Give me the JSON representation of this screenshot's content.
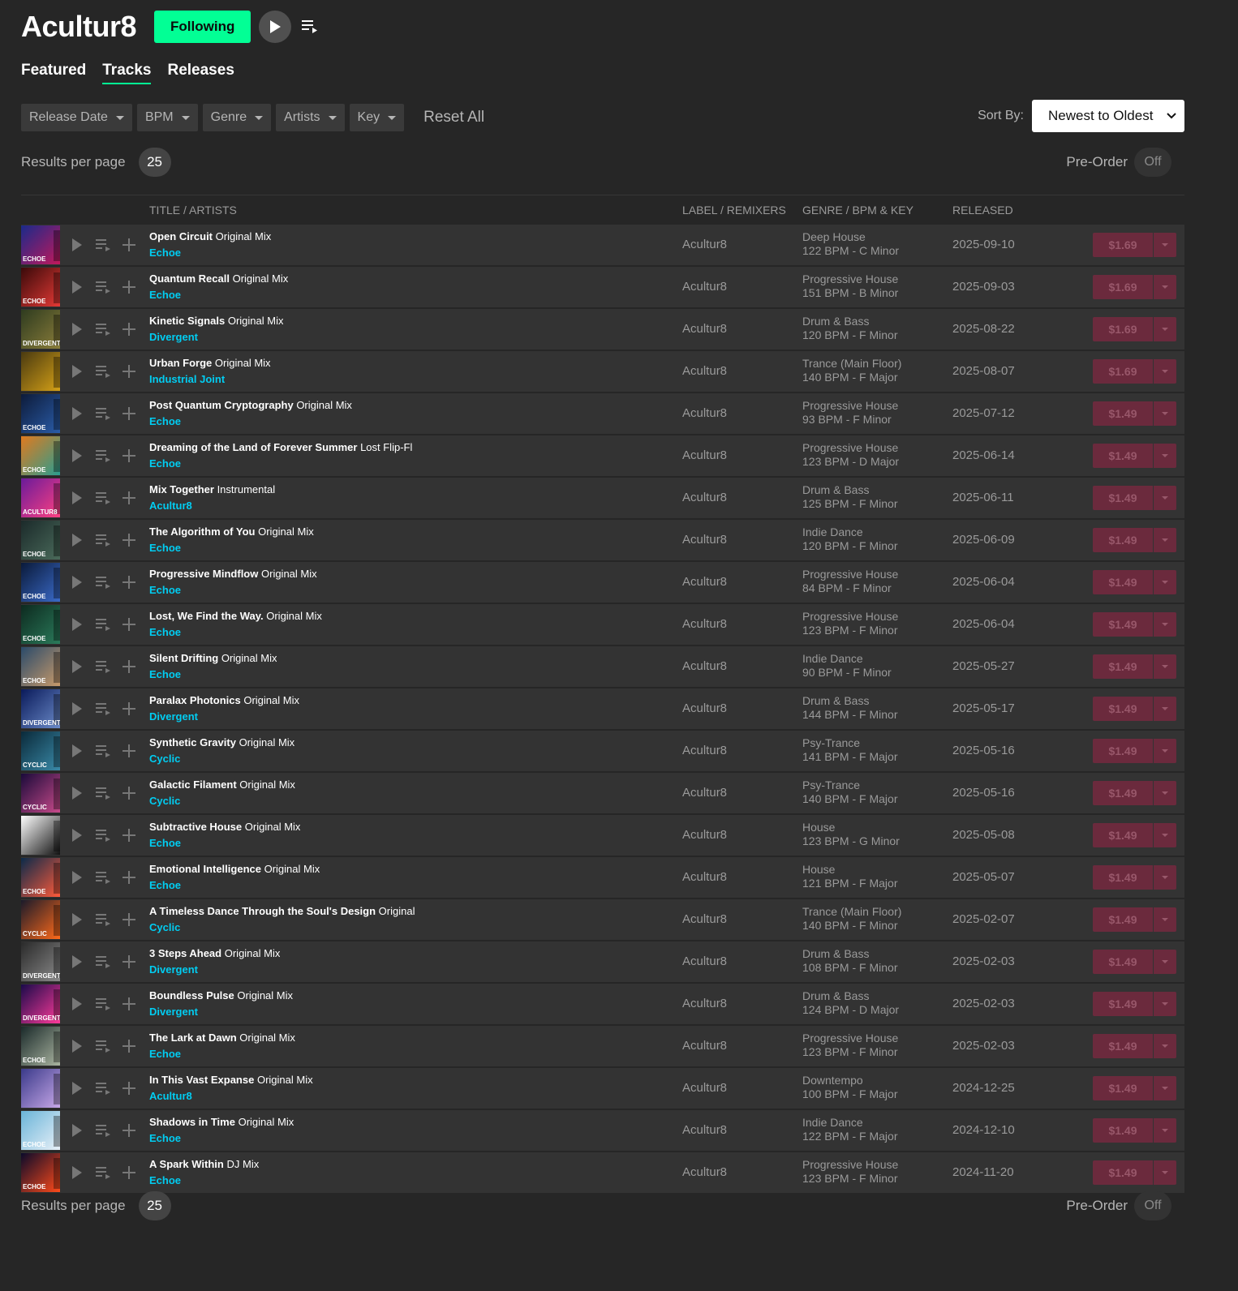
{
  "header": {
    "artist": "Acultur8",
    "follow_label": "Following"
  },
  "tabs": [
    "Featured",
    "Tracks",
    "Releases"
  ],
  "active_tab": "Tracks",
  "filters": [
    "Release Date",
    "BPM",
    "Genre",
    "Artists",
    "Key"
  ],
  "reset_label": "Reset All",
  "sort": {
    "label": "Sort By:",
    "value": "Newest to Oldest"
  },
  "results": {
    "label": "Results per page",
    "value": "25"
  },
  "preorder": {
    "label": "Pre-Order",
    "state": "Off"
  },
  "columns": {
    "title": "TITLE / ARTISTS",
    "label": "LABEL / REMIXERS",
    "genre": "GENRE / BPM & KEY",
    "released": "RELEASED"
  },
  "colors": {
    "accent": "#02ff95",
    "artist_link": "#01cdf2",
    "buy": "#6b2a3d"
  },
  "tracks": [
    {
      "title": "Open Circuit",
      "mix": "Original Mix",
      "artist": "Echoe",
      "label": "Acultur8",
      "genre": "Deep House",
      "bpm_key": "122 BPM - C Minor",
      "released": "2025-09-10",
      "price": "$1.69",
      "art": "ECHOE"
    },
    {
      "title": "Quantum Recall",
      "mix": "Original Mix",
      "artist": "Echoe",
      "label": "Acultur8",
      "genre": "Progressive House",
      "bpm_key": "151 BPM - B Minor",
      "released": "2025-09-03",
      "price": "$1.69",
      "art": "ECHOE"
    },
    {
      "title": "Kinetic Signals",
      "mix": "Original Mix",
      "artist": "Divergent",
      "label": "Acultur8",
      "genre": "Drum & Bass",
      "bpm_key": "120 BPM - F Minor",
      "released": "2025-08-22",
      "price": "$1.69",
      "art": "DIVERGENT"
    },
    {
      "title": "Urban Forge",
      "mix": "Original Mix",
      "artist": "Industrial Joint",
      "label": "Acultur8",
      "genre": "Trance (Main Floor)",
      "bpm_key": "140 BPM - F Major",
      "released": "2025-08-07",
      "price": "$1.69",
      "art": ""
    },
    {
      "title": "Post Quantum Cryptography",
      "mix": "Original Mix",
      "artist": "Echoe",
      "label": "Acultur8",
      "genre": "Progressive House",
      "bpm_key": "93 BPM - F Minor",
      "released": "2025-07-12",
      "price": "$1.49",
      "art": "ECHOE"
    },
    {
      "title": "Dreaming of the Land of Forever Summer",
      "mix": "Lost Flip-Fl",
      "artist": "Echoe",
      "label": "Acultur8",
      "genre": "Progressive House",
      "bpm_key": "123 BPM - D Major",
      "released": "2025-06-14",
      "price": "$1.49",
      "art": "ECHOE"
    },
    {
      "title": "Mix Together",
      "mix": "Instrumental",
      "artist": "Acultur8",
      "label": "Acultur8",
      "genre": "Drum & Bass",
      "bpm_key": "125 BPM - F Minor",
      "released": "2025-06-11",
      "price": "$1.49",
      "art": "ACULTUR8"
    },
    {
      "title": "The Algorithm of You",
      "mix": "Original Mix",
      "artist": "Echoe",
      "label": "Acultur8",
      "genre": "Indie Dance",
      "bpm_key": "120 BPM - F Minor",
      "released": "2025-06-09",
      "price": "$1.49",
      "art": "ECHOE"
    },
    {
      "title": "Progressive Mindflow",
      "mix": "Original Mix",
      "artist": "Echoe",
      "label": "Acultur8",
      "genre": "Progressive House",
      "bpm_key": "84 BPM - F Minor",
      "released": "2025-06-04",
      "price": "$1.49",
      "art": "ECHOE"
    },
    {
      "title": "Lost, We Find the Way.",
      "mix": "Original Mix",
      "artist": "Echoe",
      "label": "Acultur8",
      "genre": "Progressive House",
      "bpm_key": "123 BPM - F Minor",
      "released": "2025-06-04",
      "price": "$1.49",
      "art": "ECHOE"
    },
    {
      "title": "Silent Drifting",
      "mix": "Original Mix",
      "artist": "Echoe",
      "label": "Acultur8",
      "genre": "Indie Dance",
      "bpm_key": "90 BPM - F Minor",
      "released": "2025-05-27",
      "price": "$1.49",
      "art": "ECHOE"
    },
    {
      "title": "Paralax Photonics",
      "mix": "Original Mix",
      "artist": "Divergent",
      "label": "Acultur8",
      "genre": "Drum & Bass",
      "bpm_key": "144 BPM - F Minor",
      "released": "2025-05-17",
      "price": "$1.49",
      "art": "DIVERGENT"
    },
    {
      "title": "Synthetic Gravity",
      "mix": "Original Mix",
      "artist": "Cyclic",
      "label": "Acultur8",
      "genre": "Psy-Trance",
      "bpm_key": "141 BPM - F Major",
      "released": "2025-05-16",
      "price": "$1.49",
      "art": "CYCLIC"
    },
    {
      "title": "Galactic Filament",
      "mix": "Original Mix",
      "artist": "Cyclic",
      "label": "Acultur8",
      "genre": "Psy-Trance",
      "bpm_key": "140 BPM - F Major",
      "released": "2025-05-16",
      "price": "$1.49",
      "art": "CYCLIC"
    },
    {
      "title": "Subtractive House",
      "mix": "Original Mix",
      "artist": "Echoe",
      "label": "Acultur8",
      "genre": "House",
      "bpm_key": "123 BPM - G Minor",
      "released": "2025-05-08",
      "price": "$1.49",
      "art": ""
    },
    {
      "title": "Emotional Intelligence",
      "mix": "Original Mix",
      "artist": "Echoe",
      "label": "Acultur8",
      "genre": "House",
      "bpm_key": "121 BPM - F Major",
      "released": "2025-05-07",
      "price": "$1.49",
      "art": "ECHOE"
    },
    {
      "title": "A Timeless Dance Through the Soul's Design",
      "mix": "Original",
      "artist": "Cyclic",
      "label": "Acultur8",
      "genre": "Trance (Main Floor)",
      "bpm_key": "140 BPM - F Minor",
      "released": "2025-02-07",
      "price": "$1.49",
      "art": "CYCLIC"
    },
    {
      "title": "3 Steps Ahead",
      "mix": "Original Mix",
      "artist": "Divergent",
      "label": "Acultur8",
      "genre": "Drum & Bass",
      "bpm_key": "108 BPM - F Minor",
      "released": "2025-02-03",
      "price": "$1.49",
      "art": "DIVERGENT"
    },
    {
      "title": "Boundless Pulse",
      "mix": "Original Mix",
      "artist": "Divergent",
      "label": "Acultur8",
      "genre": "Drum & Bass",
      "bpm_key": "124 BPM - D Major",
      "released": "2025-02-03",
      "price": "$1.49",
      "art": "DIVERGENT"
    },
    {
      "title": "The Lark at Dawn",
      "mix": "Original Mix",
      "artist": "Echoe",
      "label": "Acultur8",
      "genre": "Progressive House",
      "bpm_key": "123 BPM - F Minor",
      "released": "2025-02-03",
      "price": "$1.49",
      "art": "ECHOE"
    },
    {
      "title": "In This Vast Expanse",
      "mix": "Original Mix",
      "artist": "Acultur8",
      "label": "Acultur8",
      "genre": "Downtempo",
      "bpm_key": "100 BPM - F Major",
      "released": "2024-12-25",
      "price": "$1.49",
      "art": ""
    },
    {
      "title": "Shadows in Time",
      "mix": "Original Mix",
      "artist": "Echoe",
      "label": "Acultur8",
      "genre": "Indie Dance",
      "bpm_key": "122 BPM - F Major",
      "released": "2024-12-10",
      "price": "$1.49",
      "art": "ECHOE"
    },
    {
      "title": "A Spark Within",
      "mix": "DJ Mix",
      "artist": "Echoe",
      "label": "Acultur8",
      "genre": "Progressive House",
      "bpm_key": "123 BPM - F Minor",
      "released": "2024-11-20",
      "price": "$1.49",
      "art": "ECHOE"
    }
  ]
}
